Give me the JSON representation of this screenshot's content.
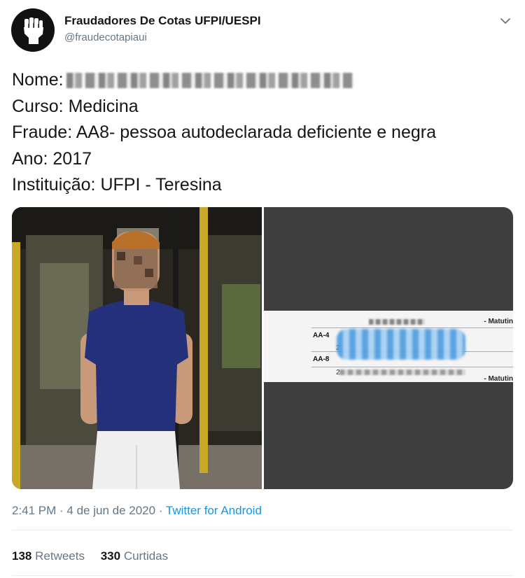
{
  "author": {
    "display_name": "Fraudadores De Cotas UFPI/UESPI",
    "handle": "@fraudecotapiaui",
    "avatar_icon": "raised-fist-icon"
  },
  "tweet": {
    "lines": [
      {
        "label": "Nome:",
        "value": ""
      },
      {
        "label": "Curso:",
        "value": "Medicina"
      },
      {
        "label": "Fraude:",
        "value": "AA8- pessoa autodeclarada deficiente e negra"
      },
      {
        "label": "Ano:",
        "value": "2017"
      },
      {
        "label": "Instituição:",
        "value": "UFPI - Teresina"
      }
    ]
  },
  "media": {
    "document_excerpt": {
      "header": "- Matutin",
      "row1_code": "AA-4",
      "row2_code": "AA-8",
      "num1": "2",
      "num2": "2",
      "footer": "- Matutin"
    }
  },
  "meta": {
    "time": "2:41 PM",
    "separator": " · ",
    "date": "4 de jun de 2020",
    "source": "Twitter for Android"
  },
  "stats": {
    "retweets_count": "138",
    "retweets_label": "Retweets",
    "likes_count": "330",
    "likes_label": "Curtidas"
  },
  "colors": {
    "link": "#1b95e0",
    "muted": "#657786",
    "text": "#14171a"
  }
}
